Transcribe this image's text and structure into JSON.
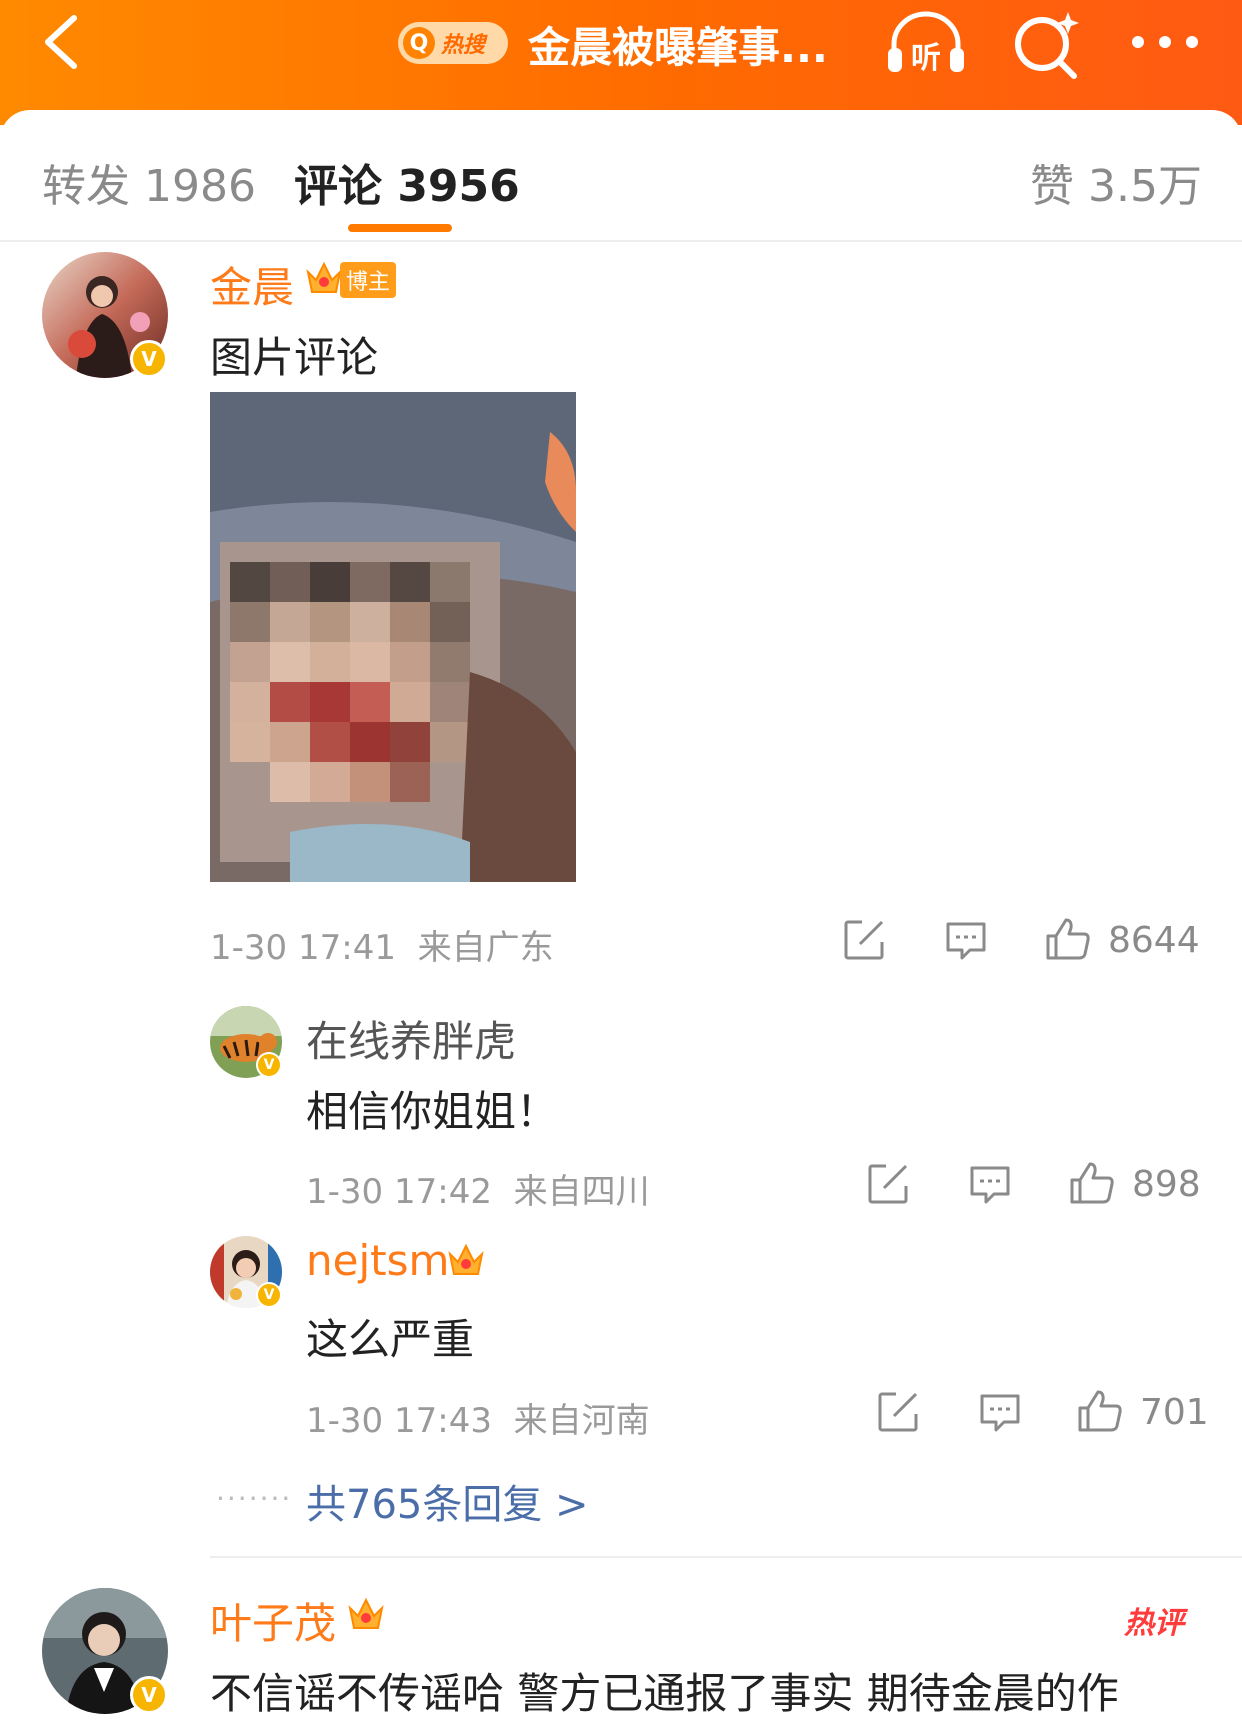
{
  "header": {
    "hot_label": "热搜",
    "title": "金晨被曝肇事...",
    "listen_label": "听",
    "accent": "#ff7a00"
  },
  "tabs": {
    "repost_label": "转发 1986",
    "comment_label": "评论 3956",
    "like_label": "赞 3.5万"
  },
  "comments": [
    {
      "user": "金晨",
      "badge": "博主",
      "text": "图片评论",
      "time": "1-30 17:41",
      "location": "来自广东",
      "likes": "8644",
      "replies": [
        {
          "user": "在线养胖虎",
          "text": "相信你姐姐！",
          "time": "1-30 17:42",
          "location": "来自四川",
          "likes": "898"
        },
        {
          "user": "nejtsm",
          "text": "这么严重",
          "time": "1-30 17:43",
          "location": "来自河南",
          "likes": "701"
        }
      ],
      "more_replies": "共765条回复 >"
    },
    {
      "user": "叶子茂",
      "hot_tag": "热评",
      "text": "不信谣不传谣哈 警方已通报了事实 期待金晨的作"
    }
  ],
  "icons": [
    "back-icon",
    "search-icon",
    "headphones-icon",
    "search-sparkle-icon",
    "more-icon",
    "share-icon",
    "comment-icon",
    "like-icon",
    "crown-icon",
    "verified-icon"
  ]
}
